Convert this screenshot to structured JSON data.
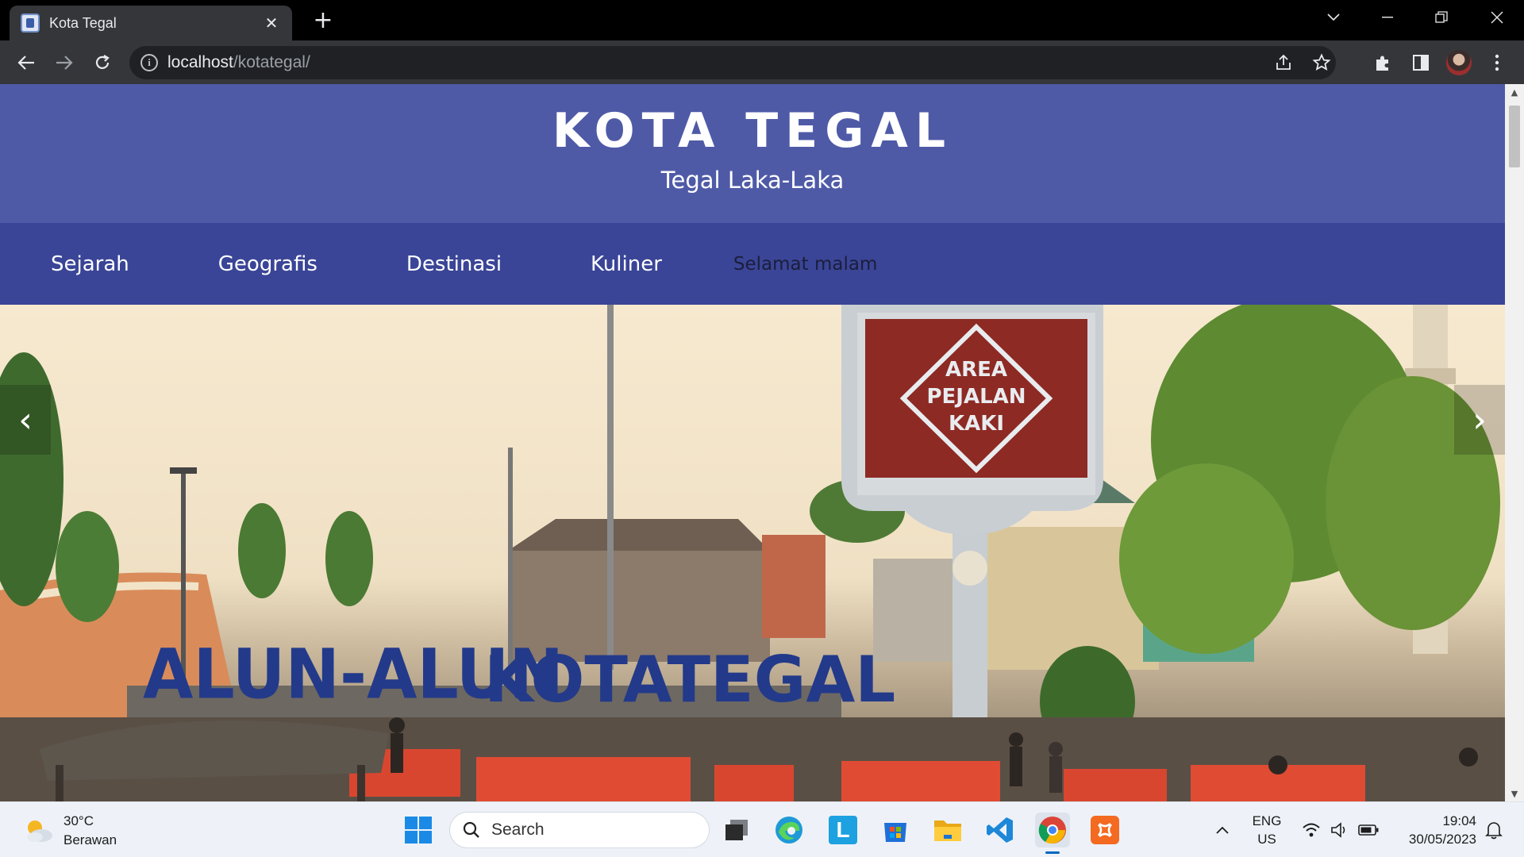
{
  "browser": {
    "tab_title": "Kota Tegal",
    "url_host": "localhost",
    "url_path": "/kotategal/"
  },
  "site": {
    "title": "KOTA TEGAL",
    "tagline": "Tegal Laka-Laka",
    "nav": [
      "Sejarah",
      "Geografis",
      "Destinasi",
      "Kuliner"
    ],
    "greeting": "Selamat malam"
  },
  "hero": {
    "sign_text": [
      "AREA",
      "PEJALAN",
      "KAKI"
    ],
    "landmark_text_1": "ALUN-ALUN",
    "landmark_text_2": "KOTATEGAL",
    "prev_arrow": "‹",
    "next_arrow": "›"
  },
  "taskbar": {
    "weather_temp": "30°C",
    "weather_desc": "Berawan",
    "search_label": "Search",
    "lang_1": "ENG",
    "lang_2": "US",
    "time": "19:04",
    "date": "30/05/2023"
  },
  "colors": {
    "header_bg": "#4f5aa7",
    "nav_bg": "#3a4597",
    "sign_red": "#8d2a24",
    "landmark_blue": "#233a8a"
  }
}
